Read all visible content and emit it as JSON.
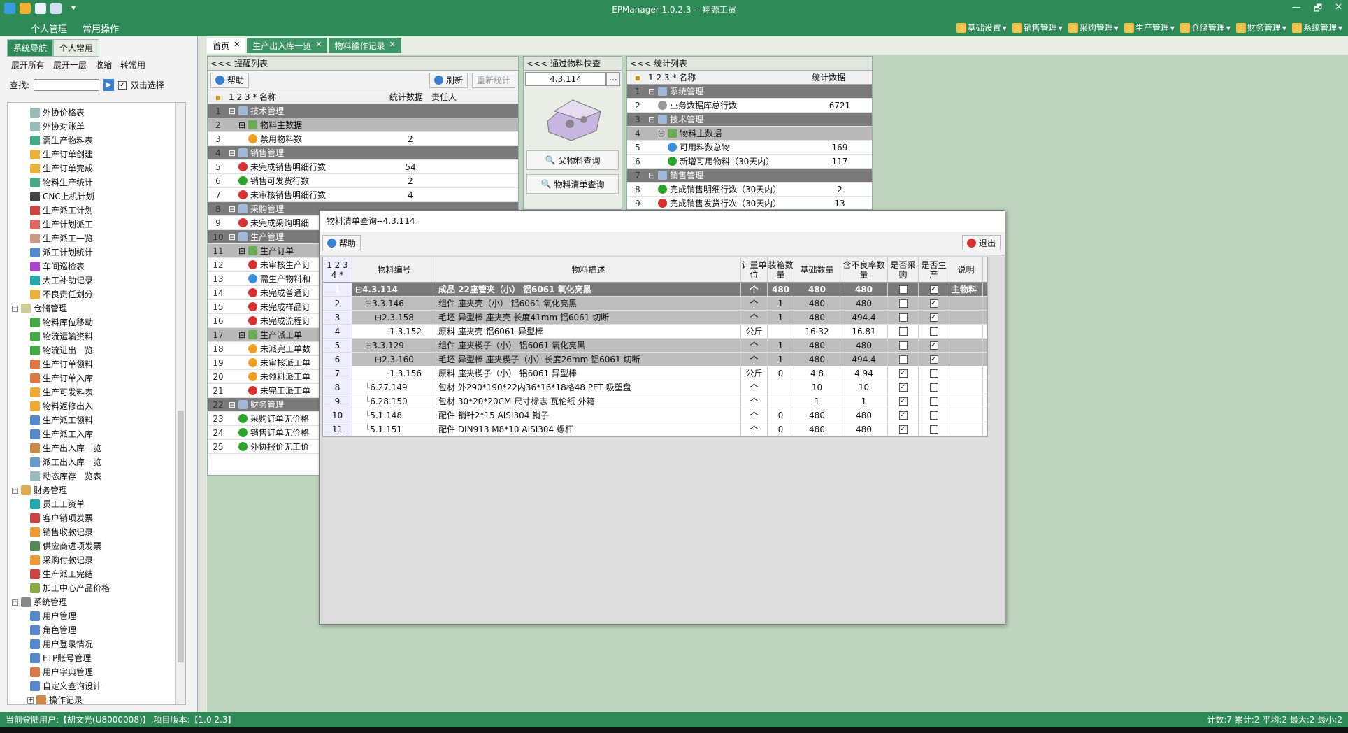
{
  "app": {
    "title": "EPManager 1.0.2.3 -- 翔源工贸",
    "window_controls": [
      "—",
      "🗗",
      "✕"
    ]
  },
  "menubar": {
    "left": [
      "个人管理",
      "常用操作"
    ],
    "right": [
      "基础设置",
      "销售管理",
      "采购管理",
      "生产管理",
      "仓储管理",
      "财务管理",
      "系统管理"
    ]
  },
  "left": {
    "tabs": [
      "系统导航",
      "个人常用"
    ],
    "tools": [
      "展开所有",
      "展开一层",
      "收缩",
      "转常用"
    ],
    "search_label": "查找:",
    "double_click_label": "双击选择",
    "tree": [
      {
        "t": "外协价格表",
        "l": 2,
        "c": "#9bb"
      },
      {
        "t": "外协对账单",
        "l": 2,
        "c": "#9bb"
      },
      {
        "t": "需生产物料表",
        "l": 2,
        "c": "#4a8"
      },
      {
        "t": "生产订单创建",
        "l": 2,
        "c": "#e9b13a"
      },
      {
        "t": "生产订单完成",
        "l": 2,
        "c": "#e9b13a"
      },
      {
        "t": "物料生产统计",
        "l": 2,
        "c": "#4a8"
      },
      {
        "t": "CNC上机计划",
        "l": 2,
        "c": "#444"
      },
      {
        "t": "生产派工计划",
        "l": 2,
        "c": "#c44"
      },
      {
        "t": "生产计划派工",
        "l": 2,
        "c": "#d66"
      },
      {
        "t": "生产派工一览",
        "l": 2,
        "c": "#c98"
      },
      {
        "t": "派工计划统计",
        "l": 2,
        "c": "#58c"
      },
      {
        "t": "车间巡检表",
        "l": 2,
        "c": "#a4c"
      },
      {
        "t": "大工补助记录",
        "l": 2,
        "c": "#2aa"
      },
      {
        "t": "不良责任划分",
        "l": 2,
        "c": "#e9b13a"
      },
      {
        "t": "仓储管理",
        "l": 1,
        "c": "#cc9",
        "ex": "−"
      },
      {
        "t": "物料库位移动",
        "l": 2,
        "c": "#4a4"
      },
      {
        "t": "物流运输资料",
        "l": 2,
        "c": "#4a4"
      },
      {
        "t": "物流进出一览",
        "l": 2,
        "c": "#4a4"
      },
      {
        "t": "生产订单领料",
        "l": 2,
        "c": "#d74"
      },
      {
        "t": "生产订单入库",
        "l": 2,
        "c": "#d74"
      },
      {
        "t": "生产可发料表",
        "l": 2,
        "c": "#ea3"
      },
      {
        "t": "物料返修出入",
        "l": 2,
        "c": "#ea3"
      },
      {
        "t": "生产派工领料",
        "l": 2,
        "c": "#58c"
      },
      {
        "t": "生产派工入库",
        "l": 2,
        "c": "#58c"
      },
      {
        "t": "生产出入库一览",
        "l": 2,
        "c": "#c84"
      },
      {
        "t": "派工出入库一览",
        "l": 2,
        "c": "#69c"
      },
      {
        "t": "动态库存一览表",
        "l": 2,
        "c": "#9bb"
      },
      {
        "t": "财务管理",
        "l": 1,
        "c": "#da5",
        "ex": "−"
      },
      {
        "t": "员工工资单",
        "l": 2,
        "c": "#2aa"
      },
      {
        "t": "客户销项发票",
        "l": 2,
        "c": "#c44"
      },
      {
        "t": "销售收款记录",
        "l": 2,
        "c": "#e93"
      },
      {
        "t": "供应商进项发票",
        "l": 2,
        "c": "#585"
      },
      {
        "t": "采购付款记录",
        "l": 2,
        "c": "#e93"
      },
      {
        "t": "生产派工完结",
        "l": 2,
        "c": "#c44"
      },
      {
        "t": "加工中心产品价格",
        "l": 2,
        "c": "#8a4"
      },
      {
        "t": "系统管理",
        "l": 1,
        "c": "#888",
        "ex": "−"
      },
      {
        "t": "用户管理",
        "l": 2,
        "c": "#58c"
      },
      {
        "t": "角色管理",
        "l": 2,
        "c": "#58c"
      },
      {
        "t": "用户登录情况",
        "l": 2,
        "c": "#58c"
      },
      {
        "t": "FTP账号管理",
        "l": 2,
        "c": "#58c"
      },
      {
        "t": "用户字典管理",
        "l": 2,
        "c": "#d74"
      },
      {
        "t": "自定义查询设计",
        "l": 2,
        "c": "#58c"
      },
      {
        "t": "操作记录",
        "l": 2,
        "c": "#c84",
        "ex": "+"
      }
    ]
  },
  "doctabs": [
    "首页",
    "生产出入库一览",
    "物料操作记录"
  ],
  "remind": {
    "header": "<<< 提醒列表",
    "help": "帮助",
    "refresh": "刷新",
    "recount": "重新统计",
    "cols": [
      "1 2 3 * 名称",
      "统计数据",
      "责任人"
    ],
    "rows": [
      {
        "n": "1",
        "name": "技术管理",
        "v": "",
        "g": 1,
        "lv": 0
      },
      {
        "n": "2",
        "name": "物料主数据",
        "v": "",
        "g": 2,
        "lv": 1
      },
      {
        "n": "3",
        "name": "禁用物料数",
        "v": "2",
        "g": 0,
        "lv": 2,
        "d": "org"
      },
      {
        "n": "4",
        "name": "销售管理",
        "v": "",
        "g": 1,
        "lv": 0
      },
      {
        "n": "5",
        "name": "未完成销售明细行数",
        "v": "54",
        "g": 0,
        "lv": 1,
        "d": "red"
      },
      {
        "n": "6",
        "name": "销售可发货行数",
        "v": "2",
        "g": 0,
        "lv": 1,
        "d": "grn"
      },
      {
        "n": "7",
        "name": "未审核销售明细行数",
        "v": "4",
        "g": 0,
        "lv": 1,
        "d": "red"
      },
      {
        "n": "8",
        "name": "采购管理",
        "v": "",
        "g": 1,
        "lv": 0
      },
      {
        "n": "9",
        "name": "未完成采购明细",
        "v": "",
        "g": 0,
        "lv": 1,
        "d": "red"
      },
      {
        "n": "10",
        "name": "生产管理",
        "v": "",
        "g": 1,
        "lv": 0
      },
      {
        "n": "11",
        "name": "生产订单",
        "v": "",
        "g": 2,
        "lv": 1
      },
      {
        "n": "12",
        "name": "未审核生产订",
        "v": "",
        "g": 0,
        "lv": 2,
        "d": "red"
      },
      {
        "n": "13",
        "name": "需生产物料和",
        "v": "",
        "g": 0,
        "lv": 2,
        "d": "blu"
      },
      {
        "n": "14",
        "name": "未完成普通订",
        "v": "",
        "g": 0,
        "lv": 2,
        "d": "red"
      },
      {
        "n": "15",
        "name": "未完成样品订",
        "v": "",
        "g": 0,
        "lv": 2,
        "d": "red"
      },
      {
        "n": "16",
        "name": "未完成流程订",
        "v": "",
        "g": 0,
        "lv": 2,
        "d": "red"
      },
      {
        "n": "17",
        "name": "生产派工单",
        "v": "",
        "g": 2,
        "lv": 1
      },
      {
        "n": "18",
        "name": "未派完工单数",
        "v": "",
        "g": 0,
        "lv": 2,
        "d": "org"
      },
      {
        "n": "19",
        "name": "未审核派工单",
        "v": "",
        "g": 0,
        "lv": 2,
        "d": "org"
      },
      {
        "n": "20",
        "name": "未领料派工单",
        "v": "",
        "g": 0,
        "lv": 2,
        "d": "org"
      },
      {
        "n": "21",
        "name": "未完工派工单",
        "v": "",
        "g": 0,
        "lv": 2,
        "d": "red"
      },
      {
        "n": "22",
        "name": "财务管理",
        "v": "",
        "g": 1,
        "lv": 0
      },
      {
        "n": "23",
        "name": "采购订单无价格",
        "v": "",
        "g": 0,
        "lv": 1,
        "d": "grn"
      },
      {
        "n": "24",
        "name": "销售订单无价格",
        "v": "",
        "g": 0,
        "lv": 1,
        "d": "grn"
      },
      {
        "n": "25",
        "name": "外协报价无工价",
        "v": "",
        "g": 0,
        "lv": 1,
        "d": "grn"
      }
    ]
  },
  "quick": {
    "header": "<<< 通过物料快查",
    "code": "4.3.114",
    "more": "...",
    "btn1": "父物料查询",
    "btn2": "物料清单查询"
  },
  "stats": {
    "header": "<<< 统计列表",
    "cols": [
      "1 2 3 * 名称",
      "统计数据"
    ],
    "rows": [
      {
        "n": "1",
        "name": "系统管理",
        "v": "",
        "g": 1,
        "lv": 0
      },
      {
        "n": "2",
        "name": "业务数据库总行数",
        "v": "6721",
        "g": 0,
        "lv": 1,
        "d": "gry"
      },
      {
        "n": "3",
        "name": "技术管理",
        "v": "",
        "g": 1,
        "lv": 0
      },
      {
        "n": "4",
        "name": "物料主数据",
        "v": "",
        "g": 2,
        "lv": 1
      },
      {
        "n": "5",
        "name": "可用料数总物",
        "v": "169",
        "g": 0,
        "lv": 2,
        "d": "blu"
      },
      {
        "n": "6",
        "name": "新增可用物料（30天内）",
        "v": "117",
        "g": 0,
        "lv": 2,
        "d": "grn"
      },
      {
        "n": "7",
        "name": "销售管理",
        "v": "",
        "g": 1,
        "lv": 0
      },
      {
        "n": "8",
        "name": "完成销售明细行数（30天内）",
        "v": "2",
        "g": 0,
        "lv": 1,
        "d": "grn"
      },
      {
        "n": "9",
        "name": "完成销售发货行次（30天内）",
        "v": "13",
        "g": 0,
        "lv": 1,
        "d": "red"
      }
    ]
  },
  "dialog": {
    "title": "物料清单查询--4.3.114",
    "help": "帮助",
    "exit": "退出",
    "cols": {
      "rn": "1 2 3 4 *",
      "code": "物料编号",
      "desc": "物料描述",
      "unit": "计量单位",
      "qty": "装箱数量",
      "base": "基础数量",
      "loss": "含不良率数量",
      "buy": "是否采购",
      "prod": "是否生产",
      "note": "说明"
    },
    "rows": [
      {
        "n": "1",
        "code": "4.3.114",
        "desc": "成品 22座管夹（小） 铝6061 氧化亮黑",
        "unit": "个",
        "qty": "480",
        "base": "480",
        "loss": "480",
        "buy": false,
        "prod": true,
        "note": "主物料",
        "g": 1,
        "lv": 0
      },
      {
        "n": "2",
        "code": "3.3.146",
        "desc": "组件 座夹壳（小） 铝6061 氧化亮黑",
        "unit": "个",
        "qty": "1",
        "base": "480",
        "loss": "480",
        "buy": false,
        "prod": true,
        "note": "",
        "g": 2,
        "lv": 1
      },
      {
        "n": "3",
        "code": "2.3.158",
        "desc": "毛坯 异型棒 座夹壳 长度41mm 铝6061 切断",
        "unit": "个",
        "qty": "1",
        "base": "480",
        "loss": "494.4",
        "buy": false,
        "prod": true,
        "note": "",
        "g": 2,
        "lv": 2
      },
      {
        "n": "4",
        "code": "1.3.152",
        "desc": "原料 座夹壳 铝6061 异型棒",
        "unit": "公斤",
        "qty": "",
        "base": "16.32",
        "loss": "16.81",
        "buy": false,
        "prod": false,
        "note": "",
        "g": 0,
        "lv": 3
      },
      {
        "n": "5",
        "code": "3.3.129",
        "desc": "组件 座夹楔子（小） 铝6061 氧化亮黑",
        "unit": "个",
        "qty": "1",
        "base": "480",
        "loss": "480",
        "buy": false,
        "prod": true,
        "note": "",
        "g": 2,
        "lv": 1
      },
      {
        "n": "6",
        "code": "2.3.160",
        "desc": "毛坯 异型棒 座夹楔子（小）长度26mm 铝6061 切断",
        "unit": "个",
        "qty": "1",
        "base": "480",
        "loss": "494.4",
        "buy": false,
        "prod": true,
        "note": "",
        "g": 2,
        "lv": 2
      },
      {
        "n": "7",
        "code": "1.3.156",
        "desc": "原料 座夹楔子（小） 铝6061 异型棒",
        "unit": "公斤",
        "qty": "0",
        "base": "4.8",
        "loss": "4.94",
        "buy": true,
        "prod": false,
        "note": "",
        "g": 0,
        "lv": 3
      },
      {
        "n": "8",
        "code": "6.27.149",
        "desc": "包材 外290*190*22内36*16*18格48 PET 吸塑盘",
        "unit": "个",
        "qty": "",
        "base": "10",
        "loss": "10",
        "buy": true,
        "prod": false,
        "note": "",
        "g": 0,
        "lv": 1
      },
      {
        "n": "9",
        "code": "6.28.150",
        "desc": "包材 30*20*20CM 尺寸标志 瓦伦纸 外箱",
        "unit": "个",
        "qty": "",
        "base": "1",
        "loss": "1",
        "buy": true,
        "prod": false,
        "note": "",
        "g": 0,
        "lv": 1
      },
      {
        "n": "10",
        "code": "5.1.148",
        "desc": "配件 销针2*15 AISI304 销子",
        "unit": "个",
        "qty": "0",
        "base": "480",
        "loss": "480",
        "buy": true,
        "prod": false,
        "note": "",
        "g": 0,
        "lv": 1
      },
      {
        "n": "11",
        "code": "5.1.151",
        "desc": "配件 DIN913 M8*10 AISI304 螺杆",
        "unit": "个",
        "qty": "0",
        "base": "480",
        "loss": "480",
        "buy": true,
        "prod": false,
        "note": "",
        "g": 0,
        "lv": 1
      }
    ]
  },
  "status": {
    "left": "当前登陆用户:【胡文光(U8000008)】,项目版本:【1.0.2.3】",
    "right": "计数:7 累计:2 平均:2 最大:2 最小:2"
  }
}
